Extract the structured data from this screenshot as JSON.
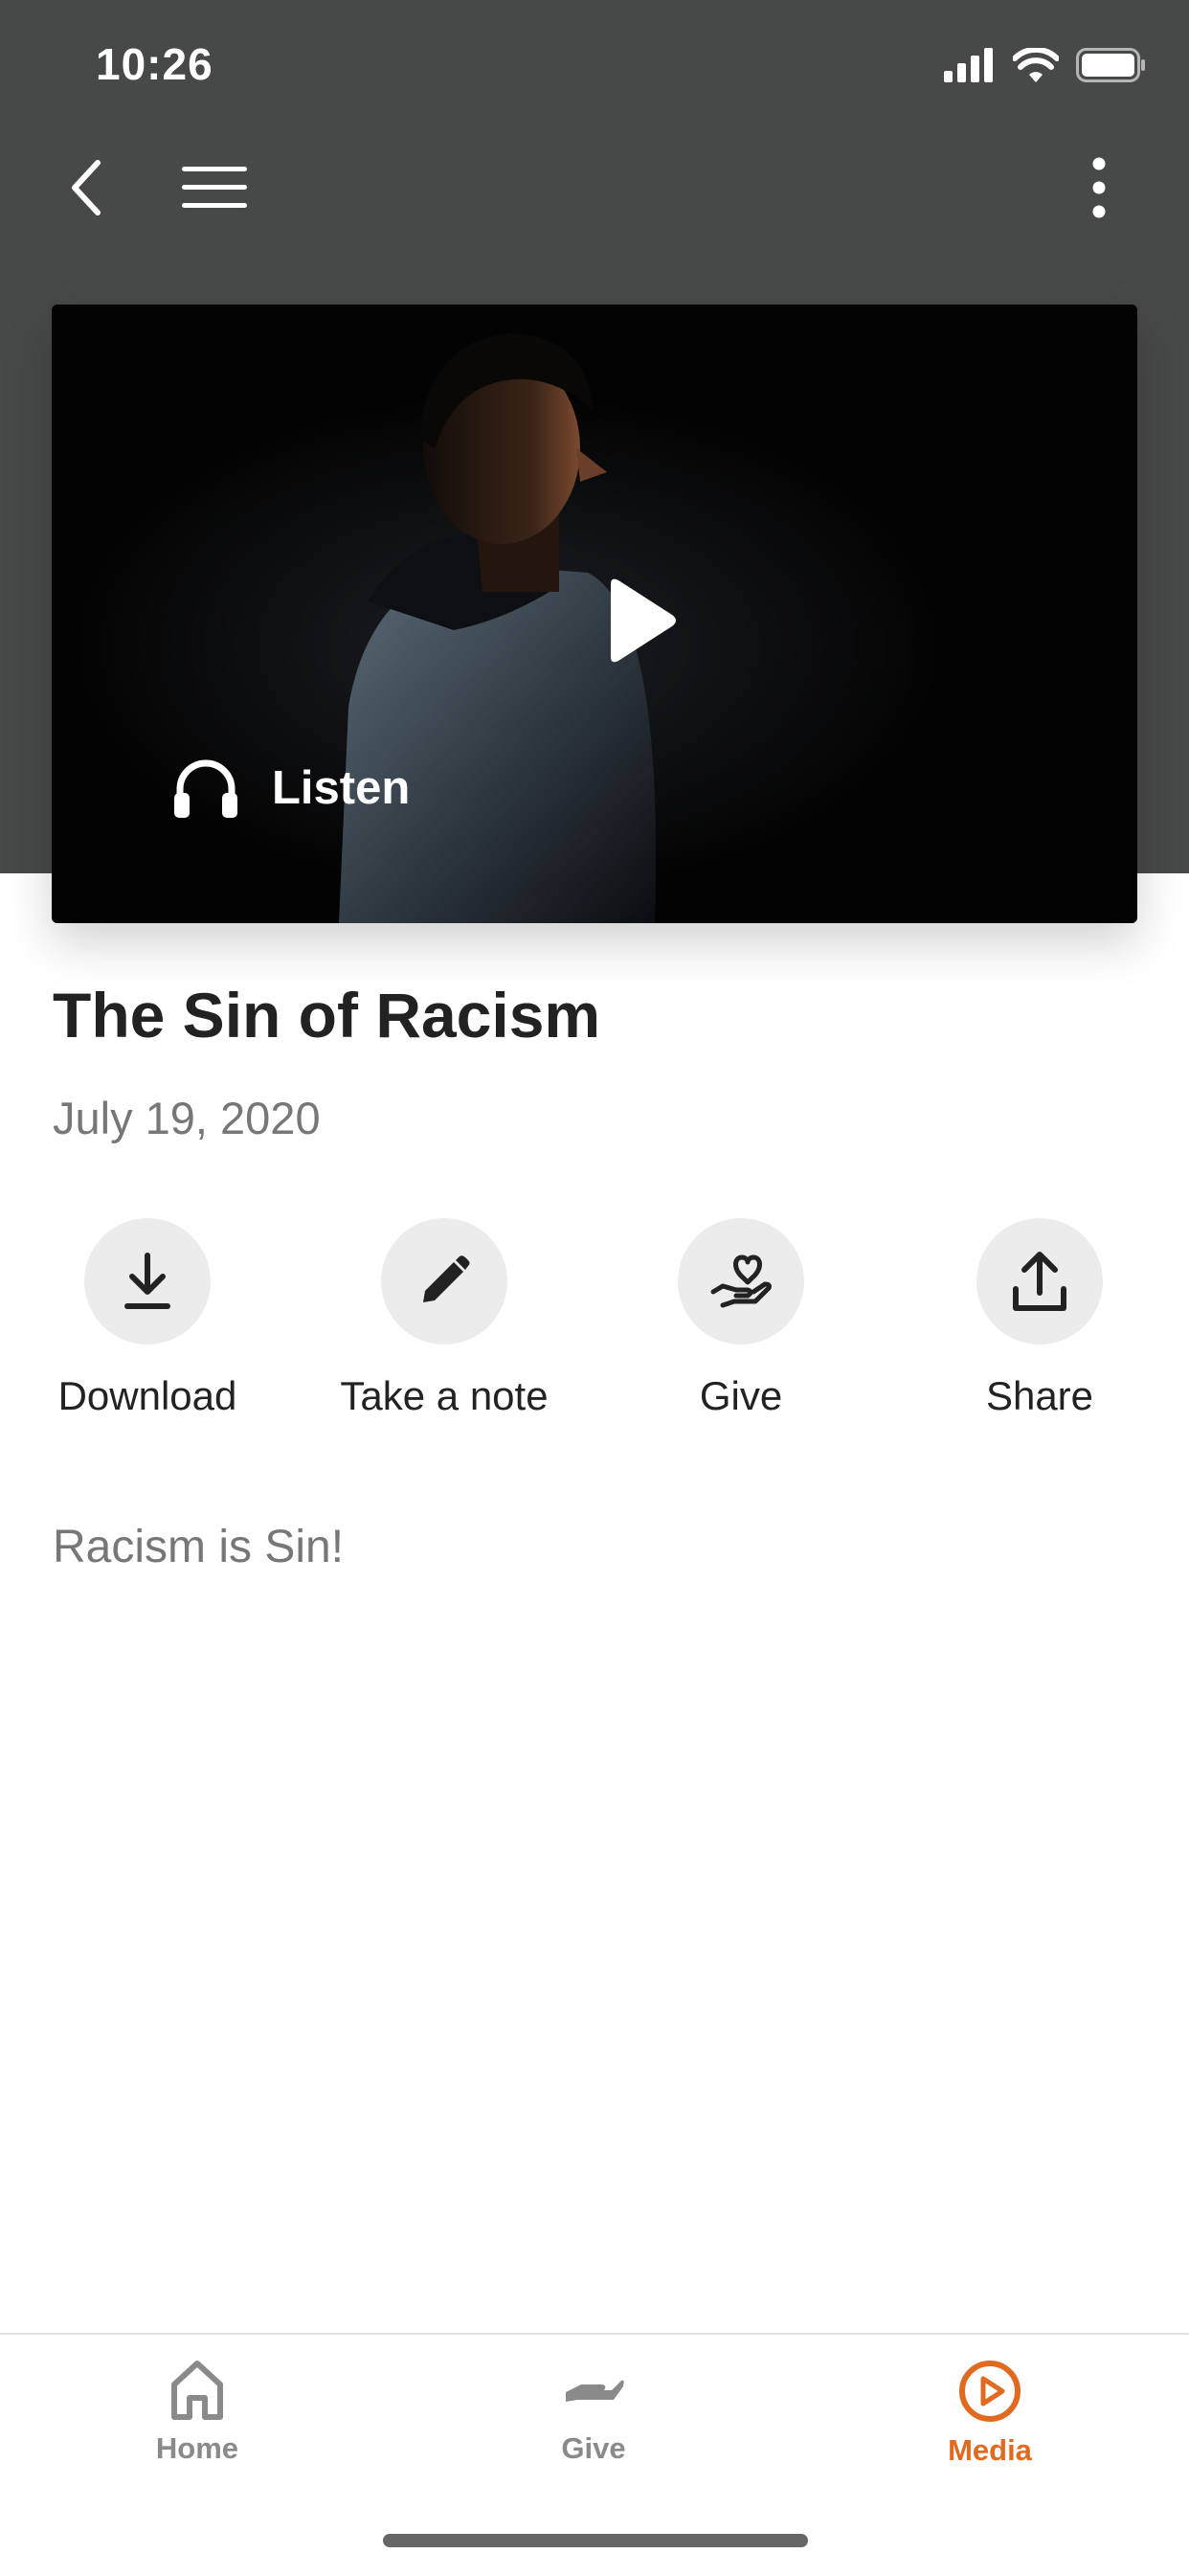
{
  "status_bar": {
    "time": "10:26",
    "icons": [
      "signal-icon",
      "wifi-icon",
      "battery-icon"
    ]
  },
  "nav": {
    "icons": [
      "back-icon",
      "menu-icon",
      "more-icon"
    ]
  },
  "media": {
    "listen_label": "Listen",
    "play_icon": "play-icon",
    "listen_icon": "headphones-icon"
  },
  "sermon": {
    "title": "The Sin of Racism",
    "date": "July 19, 2020",
    "description": "Racism is Sin!"
  },
  "actions": [
    {
      "label": "Download",
      "icon": "download-icon"
    },
    {
      "label": "Take a note",
      "icon": "pencil-icon"
    },
    {
      "label": "Give",
      "icon": "give-icon"
    },
    {
      "label": "Share",
      "icon": "share-icon"
    }
  ],
  "tabbar": {
    "items": [
      {
        "label": "Home",
        "icon": "home-icon",
        "active": false
      },
      {
        "label": "Give",
        "icon": "give-hand-icon",
        "active": false
      },
      {
        "label": "Media",
        "icon": "play-circle-icon",
        "active": true
      }
    ],
    "active_color": "#e06a1f",
    "inactive_color": "#8a8a8a"
  },
  "colors": {
    "header_bg": "#464948",
    "action_circle_bg": "#ececec"
  }
}
